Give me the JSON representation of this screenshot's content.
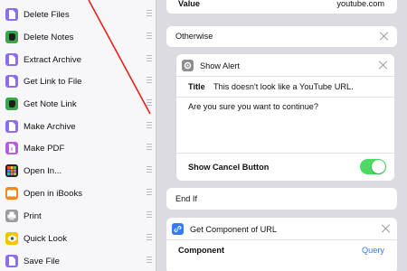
{
  "sidebar": {
    "items": [
      {
        "label": "Delete Files",
        "icon": "file-icon",
        "color": "#8b6cf2"
      },
      {
        "label": "Delete Notes",
        "icon": "evernote-icon",
        "color": "#3aa54a"
      },
      {
        "label": "Extract Archive",
        "icon": "file-icon",
        "color": "#8b6cf2"
      },
      {
        "label": "Get Link to File",
        "icon": "file-icon",
        "color": "#8b6cf2"
      },
      {
        "label": "Get Note Link",
        "icon": "evernote-icon",
        "color": "#3aa54a"
      },
      {
        "label": "Make Archive",
        "icon": "file-icon",
        "color": "#8b6cf2"
      },
      {
        "label": "Make PDF",
        "icon": "pdf-icon",
        "color": "#b85ce8"
      },
      {
        "label": "Open In...",
        "icon": "open-in-grid-icon",
        "color": "#222222"
      },
      {
        "label": "Open in iBooks",
        "icon": "ibooks-icon",
        "color": "#f08a1e"
      },
      {
        "label": "Print",
        "icon": "printer-icon",
        "color": "#9a9aa0"
      },
      {
        "label": "Quick Look",
        "icon": "quick-look-eye-icon",
        "color": "#f5c400"
      },
      {
        "label": "Save File",
        "icon": "file-icon",
        "color": "#8b6cf2"
      }
    ]
  },
  "workflow": {
    "value_row": {
      "label": "Value",
      "value": "youtube.com"
    },
    "otherwise": {
      "label": "Otherwise"
    },
    "show_alert": {
      "title": "Show Alert",
      "title_field_label": "Title",
      "title_field_value": "This doesn't look like a YouTube URL.",
      "message": "Are you sure you want to continue?",
      "cancel_label": "Show Cancel Button",
      "cancel_on": true
    },
    "end_if": {
      "label": "End If"
    },
    "get_component": {
      "title": "Get Component of URL",
      "component_label": "Component",
      "component_value": "Query"
    }
  },
  "colors": {
    "accent": "#2f7cf6",
    "toggle_on": "#4cd964",
    "annotation": "#e8201c"
  }
}
